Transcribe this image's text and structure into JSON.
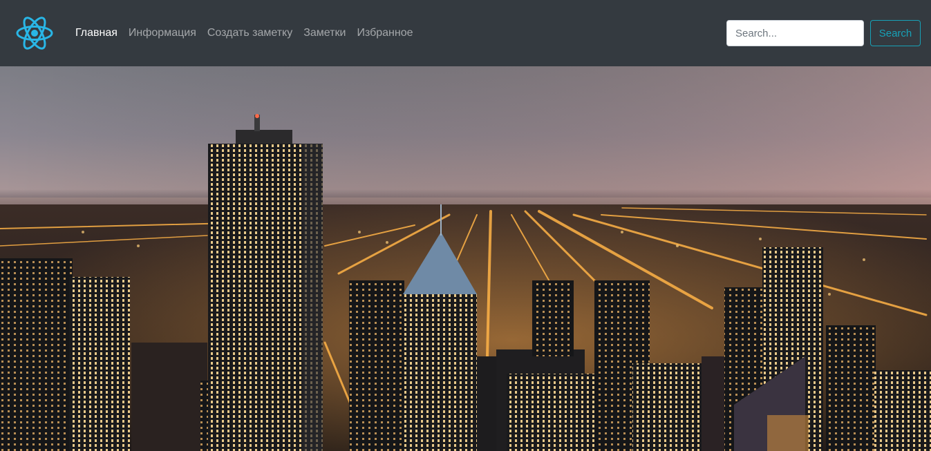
{
  "navbar": {
    "logo_icon": "react-atom-icon",
    "links": [
      {
        "label": "Главная",
        "active": true
      },
      {
        "label": "Информация",
        "active": false
      },
      {
        "label": "Создать заметку",
        "active": false
      },
      {
        "label": "Заметки",
        "active": false
      },
      {
        "label": "Избранное",
        "active": false
      }
    ],
    "search": {
      "placeholder": "Search...",
      "value": "",
      "button_label": "Search"
    }
  },
  "colors": {
    "navbar_bg": "#343a40",
    "accent": "#17a2b8",
    "logo": "#29b6e6"
  },
  "hero": {
    "image_subject": "night-city-skyline-photo"
  }
}
